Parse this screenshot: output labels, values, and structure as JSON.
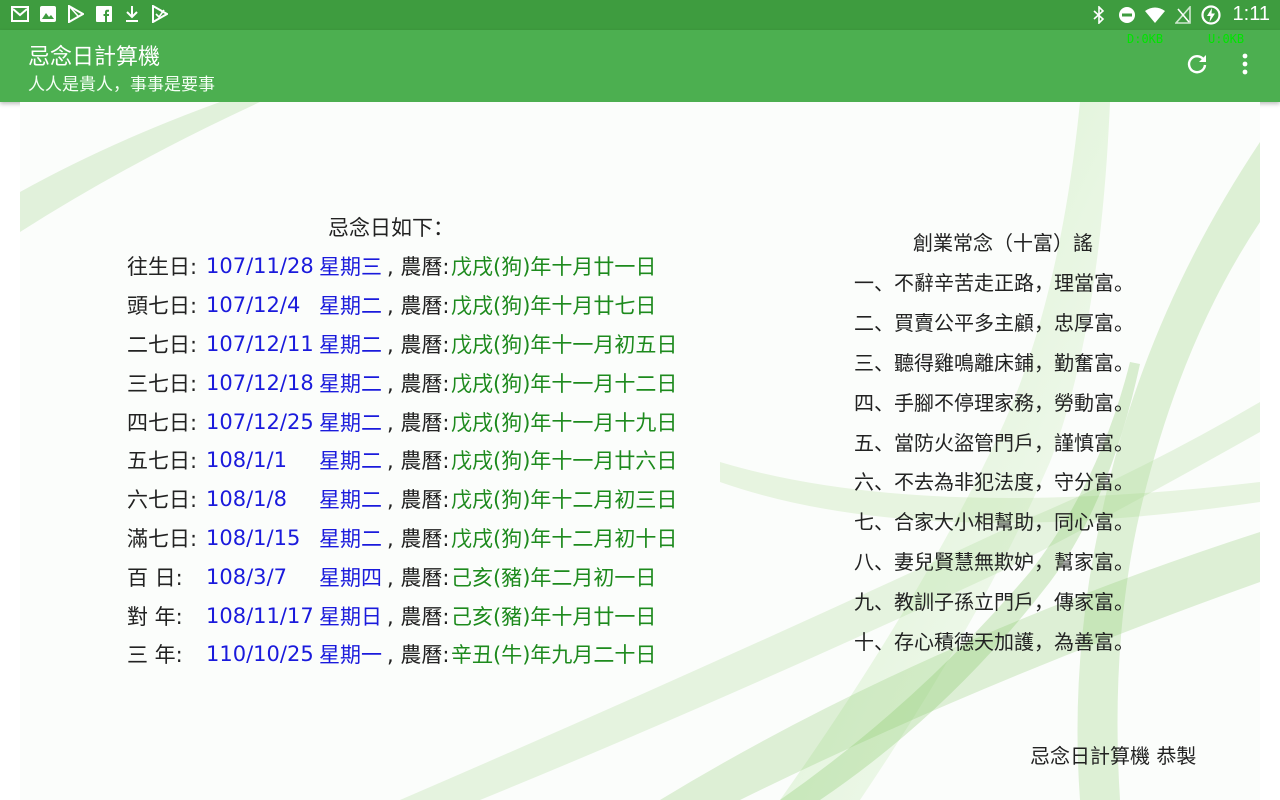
{
  "status_bar": {
    "time": "1:11",
    "left_icons": [
      "mail-icon",
      "image-icon",
      "play-store-icon",
      "facebook-icon",
      "download-icon",
      "play-check-icon"
    ],
    "right_icons": [
      "bluetooth-icon",
      "do-not-disturb-icon",
      "wifi-icon",
      "signal-icon",
      "battery-icon"
    ]
  },
  "app_bar": {
    "title": "忌念日計算機",
    "subtitle": "人人是貴人，事事是要事",
    "download_speed": "D:0KB",
    "upload_speed": "U:0KB"
  },
  "memorial": {
    "heading": "忌念日如下：",
    "rows": [
      {
        "label": "往生日:",
        "date": "107/11/28",
        "weekday": "星期三",
        "lunar_label": ", 農曆:",
        "lunar": "戊戌(狗)年十月廿一日"
      },
      {
        "label": "頭七日:",
        "date": "107/12/4",
        "weekday": "星期二",
        "lunar_label": ", 農曆:",
        "lunar": "戊戌(狗)年十月廿七日"
      },
      {
        "label": "二七日:",
        "date": "107/12/11",
        "weekday": "星期二",
        "lunar_label": ", 農曆:",
        "lunar": "戊戌(狗)年十一月初五日"
      },
      {
        "label": "三七日:",
        "date": "107/12/18",
        "weekday": "星期二",
        "lunar_label": ", 農曆:",
        "lunar": "戊戌(狗)年十一月十二日"
      },
      {
        "label": "四七日:",
        "date": "107/12/25",
        "weekday": "星期二",
        "lunar_label": ", 農曆:",
        "lunar": "戊戌(狗)年十一月十九日"
      },
      {
        "label": "五七日:",
        "date": "108/1/1",
        "weekday": "星期二",
        "lunar_label": ", 農曆:",
        "lunar": "戊戌(狗)年十一月廿六日"
      },
      {
        "label": "六七日:",
        "date": "108/1/8",
        "weekday": "星期二",
        "lunar_label": ", 農曆:",
        "lunar": "戊戌(狗)年十二月初三日"
      },
      {
        "label": "滿七日:",
        "date": "108/1/15",
        "weekday": "星期二",
        "lunar_label": ", 農曆:",
        "lunar": "戊戌(狗)年十二月初十日"
      },
      {
        "label": "百 日:",
        "date": "108/3/7",
        "weekday": "星期四",
        "lunar_label": ", 農曆:",
        "lunar": "己亥(豬)年二月初一日"
      },
      {
        "label": "對 年:",
        "date": "108/11/17",
        "weekday": "星期日",
        "lunar_label": ", 農曆:",
        "lunar": "己亥(豬)年十月廿一日"
      },
      {
        "label": "三 年:",
        "date": "110/10/25",
        "weekday": "星期一",
        "lunar_label": ", 農曆:",
        "lunar": "辛丑(牛)年九月二十日"
      }
    ]
  },
  "sayings": {
    "heading": "創業常念（十富）謠",
    "items": [
      "一、不辭辛苦走正路，理當富。",
      "二、買賣公平多主顧，忠厚富。",
      "三、聽得雞鳴離床鋪，勤奮富。",
      "四、手腳不停理家務，勞動富。",
      "五、當防火盜管門戶，謹慎富。",
      "六、不去為非犯法度，守分富。",
      "七、合家大小相幫助，同心富。",
      "八、妻兒賢慧無欺妒，幫家富。",
      "九、教訓子孫立門戶，傳家富。",
      "十、存心積德天加護，為善富。"
    ]
  },
  "footer": "忌念日計算機 恭製",
  "colors": {
    "status_bar": "#3e9c3f",
    "app_bar": "#4caf50",
    "date_text": "#1a1adc",
    "lunar_text": "#1d8a1d",
    "traffic_text": "#00e400"
  }
}
